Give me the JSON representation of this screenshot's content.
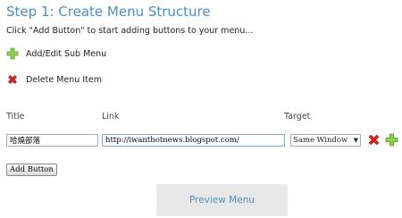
{
  "heading": "Step 1: Create Menu Structure",
  "intro": "Click \"Add Button\" to start adding buttons to your menu...",
  "legend": {
    "add_label": "Add/Edit Sub Menu",
    "add_icon": "plus-icon",
    "delete_label": "Delete Menu Item",
    "delete_icon": "delete-x-icon"
  },
  "columns": {
    "title": "Title",
    "link": "Link",
    "target": "Target"
  },
  "row": {
    "title_value": "哈燒部落",
    "link_value": "http://iwanthotnews.blogspot.com/",
    "target_value": "Same Window"
  },
  "add_button_label": "Add Button",
  "preview_button_label": "Preview Menu",
  "colors": {
    "heading": "#4a8fc2",
    "plus_green": "#7cc142",
    "delete_red": "#d9261c"
  }
}
